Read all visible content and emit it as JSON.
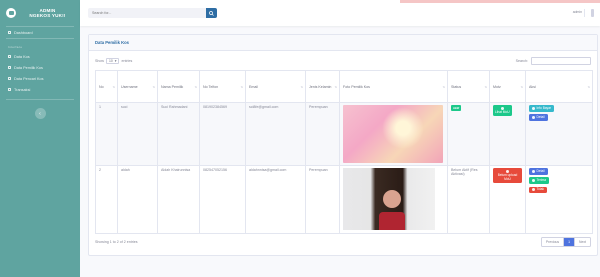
{
  "brand": {
    "line1": "ADMIN",
    "line2": "NGEKOS YUK!!"
  },
  "sidebar": {
    "dashboard": "Dashboard",
    "heading": "Interface",
    "items": [
      {
        "label": "Data Kos"
      },
      {
        "label": "Data Pemilik Kos"
      },
      {
        "label": "Data Pencari Kos"
      },
      {
        "label": "Transaksi"
      }
    ],
    "toggle_glyph": "‹"
  },
  "topbar": {
    "search_placeholder": "Search for...",
    "user": "admin"
  },
  "card": {
    "title": "Data Pemilik Kos"
  },
  "datatable": {
    "show_label": "Show",
    "page_length": "10",
    "entries_label": "entries",
    "search_label": "Search:",
    "info": "Showing 1 to 2 of 2 entries",
    "pagination": {
      "previous": "Previous",
      "current": "1",
      "next": "Next"
    }
  },
  "table": {
    "headers": [
      "No",
      "Username",
      "Nama Pemilik",
      "No Telfon",
      "Email",
      "Jenis Kelamin",
      "Foto Pemilik Kos",
      "Status",
      "Motz",
      "Aksi"
    ],
    "rows": [
      {
        "no": "1",
        "username": "suci",
        "nama": "Suci Rahmadani",
        "telfon": "081902384569",
        "email": "sci8fe@gmail.com",
        "gender": "Perempuan",
        "status_badge": "Aktif",
        "motz_button": "Lihat MoU",
        "actions": [
          "Info Bayar",
          "Detail"
        ]
      },
      {
        "no": "2",
        "username": "aldah",
        "nama": "Aldah Khairunnisa",
        "telfon": "082547052156",
        "email": "aldahnnisa@gmail.com",
        "gender": "Perempuan",
        "status_text": "Belum Aktif (Res Aktivasi)",
        "motz_button": "Belum upload MoU",
        "actions": [
          "Detail",
          "Terima",
          "Tolak"
        ]
      }
    ]
  },
  "colors": {
    "sidebar": "#5fa4a0",
    "primary": "#4e73df",
    "success": "#1cc88a",
    "danger": "#e74a3b",
    "info": "#36b9cc"
  }
}
